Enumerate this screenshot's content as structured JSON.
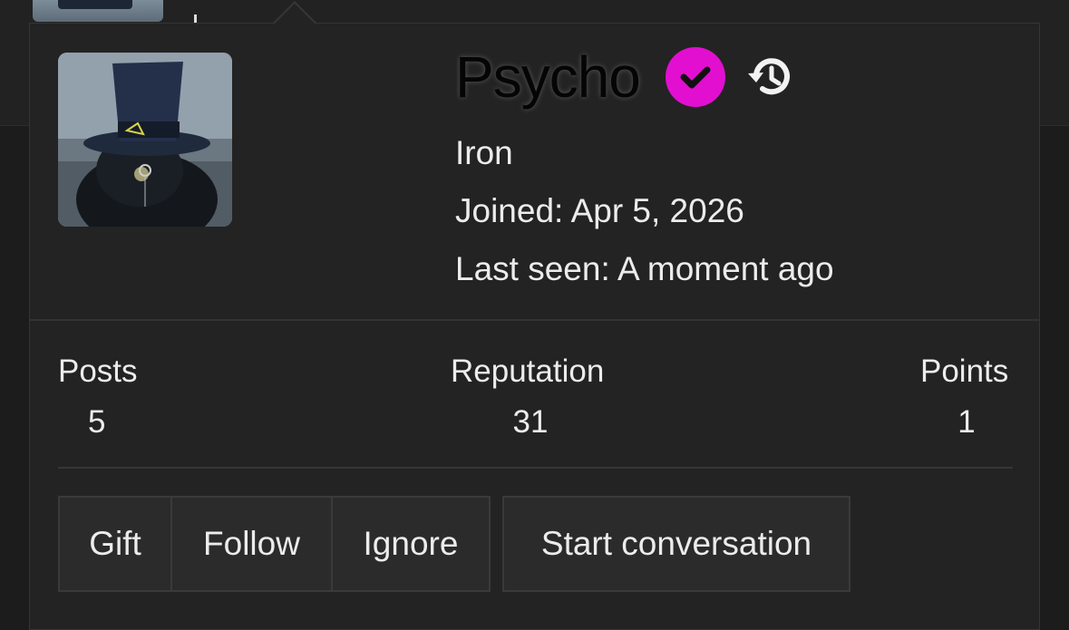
{
  "profile": {
    "username": "Psycho",
    "rank": "Iron",
    "joined_label": "Joined:",
    "joined_value": "Apr 5, 2026",
    "last_seen_label": "Last seen:",
    "last_seen_value": "A moment ago"
  },
  "stats": [
    {
      "label": "Posts",
      "value": "5"
    },
    {
      "label": "Reputation",
      "value": "31"
    },
    {
      "label": "Points",
      "value": "1"
    }
  ],
  "actions": {
    "gift": "Gift",
    "follow": "Follow",
    "ignore": "Ignore",
    "start_conversation": "Start conversation"
  },
  "icons": {
    "verified": "check-badge-icon",
    "history": "history-icon"
  },
  "colors": {
    "verified_badge": "#e20fd0",
    "card_background": "#232323",
    "page_background": "#1c1c1c"
  }
}
